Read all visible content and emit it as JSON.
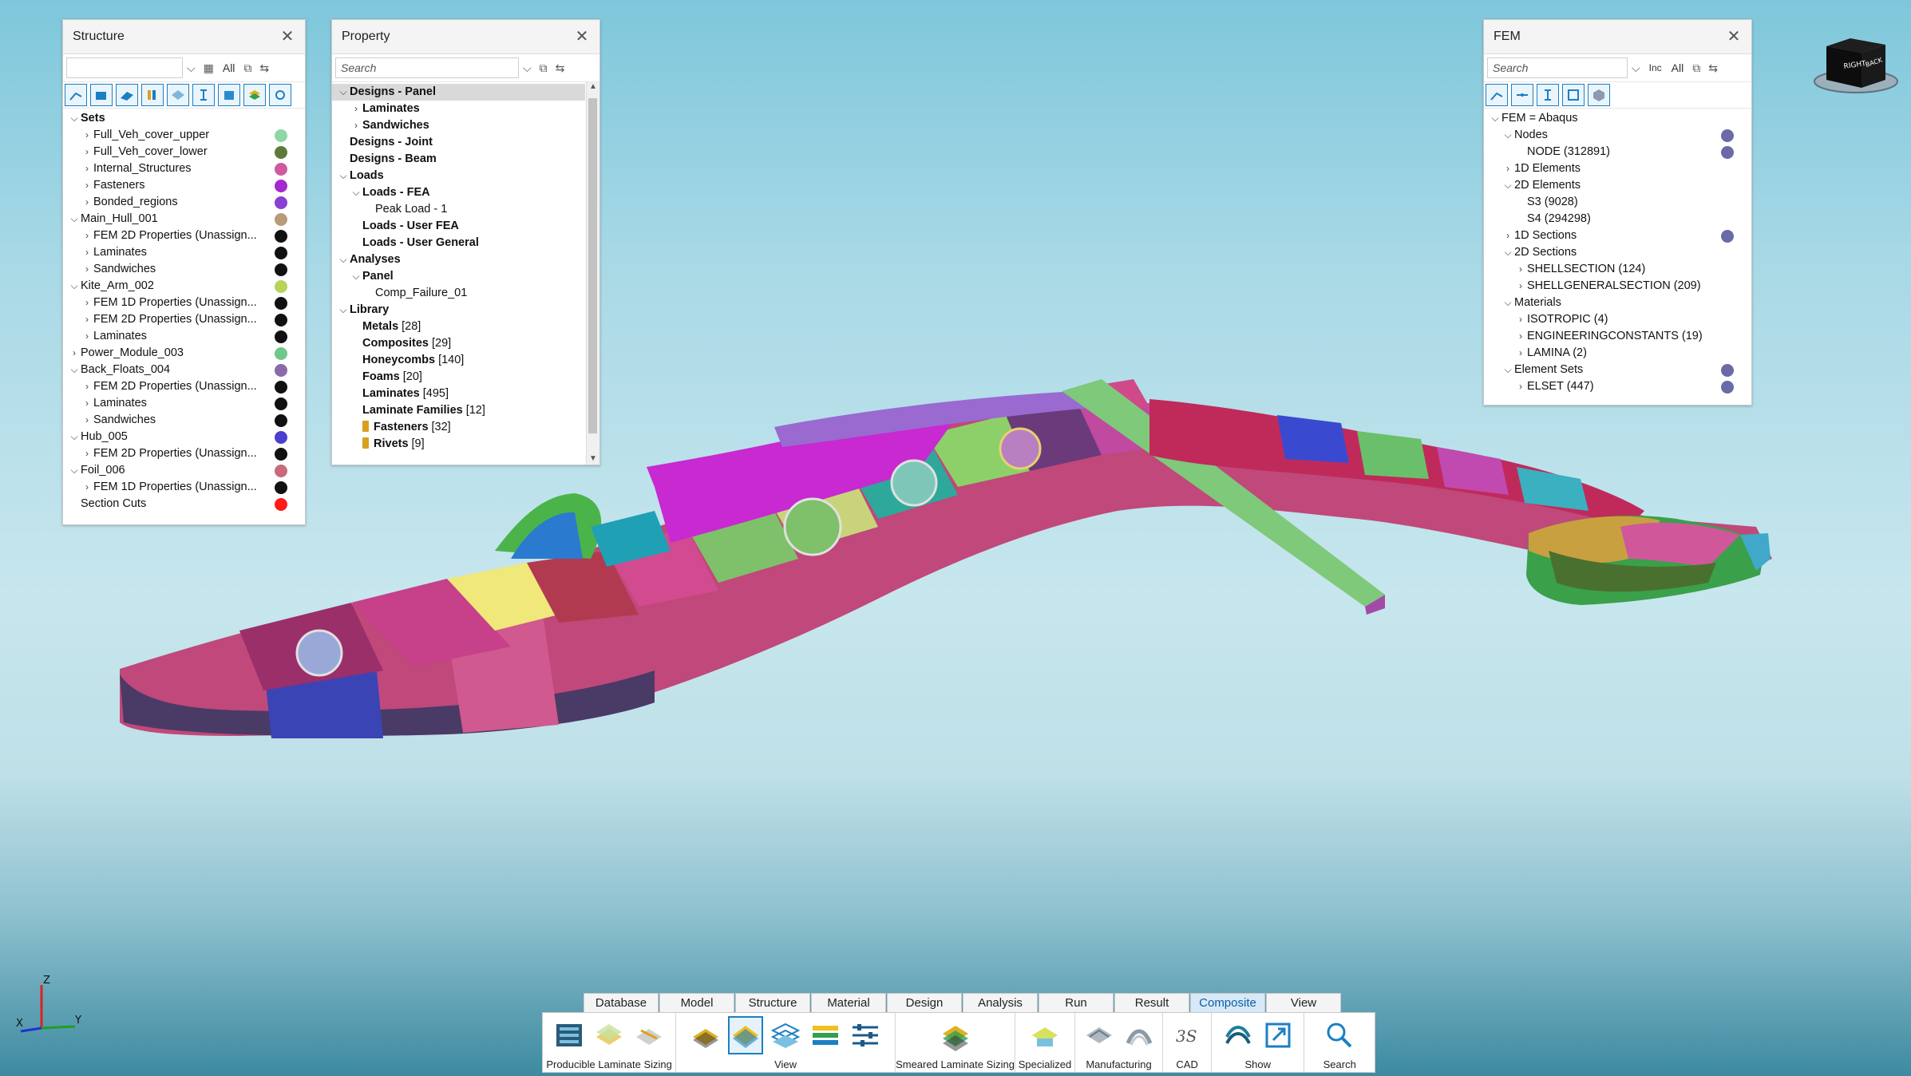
{
  "structure_panel": {
    "title": "Structure",
    "filter_all": "All",
    "tree": [
      {
        "label": "Sets",
        "bold": true,
        "level": 0,
        "expander": "open"
      },
      {
        "label": "Full_Veh_cover_upper",
        "level": 1,
        "expander": "closed",
        "color": "#8fd6a6"
      },
      {
        "label": "Full_Veh_cover_lower",
        "level": 1,
        "expander": "closed",
        "color": "#5e7a3a"
      },
      {
        "label": "Internal_Structures",
        "level": 1,
        "expander": "closed",
        "color": "#d05aa0"
      },
      {
        "label": "Fasteners",
        "level": 1,
        "expander": "closed",
        "color": "#a329d0"
      },
      {
        "label": "Bonded_regions",
        "level": 1,
        "expander": "closed",
        "color": "#8a3fd6"
      },
      {
        "label": "Main_Hull_001",
        "level": 0,
        "expander": "open",
        "color": "#b79b7a"
      },
      {
        "label": "FEM 2D Properties (Unassign...",
        "level": 1,
        "expander": "closed",
        "color": "#111111"
      },
      {
        "label": "Laminates",
        "level": 1,
        "expander": "closed",
        "color": "#111111"
      },
      {
        "label": "Sandwiches",
        "level": 1,
        "expander": "closed",
        "color": "#111111"
      },
      {
        "label": "Kite_Arm_002",
        "level": 0,
        "expander": "open",
        "color": "#b7d35a"
      },
      {
        "label": "FEM 1D Properties (Unassign...",
        "level": 1,
        "expander": "closed",
        "color": "#111111"
      },
      {
        "label": "FEM 2D Properties (Unassign...",
        "level": 1,
        "expander": "closed",
        "color": "#111111"
      },
      {
        "label": "Laminates",
        "level": 1,
        "expander": "closed",
        "color": "#111111"
      },
      {
        "label": "Power_Module_003",
        "level": 0,
        "expander": "closed",
        "color": "#6fc78a"
      },
      {
        "label": "Back_Floats_004",
        "level": 0,
        "expander": "open",
        "color": "#8a6aa8"
      },
      {
        "label": "FEM 2D Properties (Unassign...",
        "level": 1,
        "expander": "closed",
        "color": "#111111"
      },
      {
        "label": "Laminates",
        "level": 1,
        "expander": "closed",
        "color": "#111111"
      },
      {
        "label": "Sandwiches",
        "level": 1,
        "expander": "closed",
        "color": "#111111"
      },
      {
        "label": "Hub_005",
        "level": 0,
        "expander": "open",
        "color": "#4a3fd0"
      },
      {
        "label": "FEM 2D Properties (Unassign...",
        "level": 1,
        "expander": "closed",
        "color": "#111111"
      },
      {
        "label": "Foil_006",
        "level": 0,
        "expander": "open",
        "color": "#c86a7a"
      },
      {
        "label": "FEM 1D Properties (Unassign...",
        "level": 1,
        "expander": "closed",
        "color": "#111111"
      },
      {
        "label": "Section Cuts",
        "level": 0,
        "expander": "none",
        "color": "#ff1a1a"
      }
    ]
  },
  "property_panel": {
    "title": "Property",
    "search_placeholder": "Search",
    "tree": [
      {
        "label": "Designs - Panel",
        "bold": true,
        "level": 0,
        "expander": "open",
        "selected": true
      },
      {
        "label": "Laminates",
        "bold": true,
        "level": 1,
        "expander": "closed"
      },
      {
        "label": "Sandwiches",
        "bold": true,
        "level": 1,
        "expander": "closed"
      },
      {
        "label": "Designs - Joint",
        "bold": true,
        "level": 0,
        "expander": "none"
      },
      {
        "label": "Designs - Beam",
        "bold": true,
        "level": 0,
        "expander": "none"
      },
      {
        "label": "Loads",
        "bold": true,
        "level": 0,
        "expander": "open"
      },
      {
        "label": "Loads - FEA",
        "bold": true,
        "level": 1,
        "expander": "open"
      },
      {
        "label": "Peak Load - 1",
        "bold": false,
        "level": 2,
        "expander": "none"
      },
      {
        "label": "Loads - User FEA",
        "bold": true,
        "level": 1,
        "expander": "none"
      },
      {
        "label": "Loads - User General",
        "bold": true,
        "level": 1,
        "expander": "none"
      },
      {
        "label": "Analyses",
        "bold": true,
        "level": 0,
        "expander": "open"
      },
      {
        "label": "Panel",
        "bold": true,
        "level": 1,
        "expander": "open"
      },
      {
        "label": "Comp_Failure_01",
        "bold": false,
        "level": 2,
        "expander": "none"
      },
      {
        "label": "Library",
        "bold": true,
        "level": 0,
        "expander": "open"
      },
      {
        "label": "Metals",
        "count": "[28]",
        "bold": true,
        "level": 1,
        "expander": "none"
      },
      {
        "label": "Composites",
        "count": "[29]",
        "bold": true,
        "level": 1,
        "expander": "none"
      },
      {
        "label": "Honeycombs",
        "count": "[140]",
        "bold": true,
        "level": 1,
        "expander": "none"
      },
      {
        "label": "Foams",
        "count": "[20]",
        "bold": true,
        "level": 1,
        "expander": "none"
      },
      {
        "label": "Laminates",
        "count": "[495]",
        "bold": true,
        "level": 1,
        "expander": "none"
      },
      {
        "label": "Laminate Families",
        "count": "[12]",
        "bold": true,
        "level": 1,
        "expander": "none"
      },
      {
        "label": "Fasteners",
        "count": "[32]",
        "bold": true,
        "level": 1,
        "expander": "none",
        "icon": "bolt-icon"
      },
      {
        "label": "Rivets",
        "count": "[9]",
        "bold": true,
        "level": 1,
        "expander": "none",
        "icon": "rivet-icon"
      }
    ]
  },
  "fem_panel": {
    "title": "FEM",
    "search_placeholder": "Search",
    "filter_inc": "Inc",
    "filter_all": "All",
    "tree": [
      {
        "label": "FEM = Abaqus",
        "level": 0,
        "expander": "open"
      },
      {
        "label": "Nodes",
        "level": 1,
        "expander": "open",
        "dot": true
      },
      {
        "label": "NODE (312891)",
        "level": 2,
        "expander": "none",
        "dot": true
      },
      {
        "label": "1D Elements",
        "level": 1,
        "expander": "closed"
      },
      {
        "label": "2D Elements",
        "level": 1,
        "expander": "open"
      },
      {
        "label": "S3 (9028)",
        "level": 2,
        "expander": "none"
      },
      {
        "label": "S4 (294298)",
        "level": 2,
        "expander": "none"
      },
      {
        "label": "1D Sections",
        "level": 1,
        "expander": "closed",
        "dot": true
      },
      {
        "label": "2D Sections",
        "level": 1,
        "expander": "open"
      },
      {
        "label": "SHELLSECTION (124)",
        "level": 2,
        "expander": "closed"
      },
      {
        "label": "SHELLGENERALSECTION (209)",
        "level": 2,
        "expander": "closed"
      },
      {
        "label": "Materials",
        "level": 1,
        "expander": "open"
      },
      {
        "label": "ISOTROPIC (4)",
        "level": 2,
        "expander": "closed"
      },
      {
        "label": "ENGINEERINGCONSTANTS (19)",
        "level": 2,
        "expander": "closed"
      },
      {
        "label": "LAMINA (2)",
        "level": 2,
        "expander": "closed"
      },
      {
        "label": "Element Sets",
        "level": 1,
        "expander": "open",
        "dot": true
      },
      {
        "label": "ELSET (447)",
        "level": 2,
        "expander": "closed",
        "dot": true
      }
    ],
    "dot_color": "#6a6aa8"
  },
  "viewcube": {
    "face_right": "RIGHT",
    "face_back": "BACK"
  },
  "ribbon": {
    "tabs": [
      "Database",
      "Model",
      "Structure",
      "Material",
      "Design",
      "Analysis",
      "Run",
      "Result",
      "Composite",
      "View"
    ],
    "active_tab": "Composite",
    "groups": [
      {
        "label": "Producible Laminate Sizing",
        "icons": 3
      },
      {
        "label": "View",
        "icons": 5
      },
      {
        "label": "Smeared Laminate Sizing",
        "icons": 1
      },
      {
        "label": "Specialized",
        "icons": 1
      },
      {
        "label": "Manufacturing",
        "icons": 2
      },
      {
        "label": "CAD",
        "icons": 1
      },
      {
        "label": "Show",
        "icons": 2
      },
      {
        "label": "Search",
        "icons": 1
      }
    ]
  },
  "axes": {
    "z": "Z",
    "y": "Y",
    "x": "X"
  }
}
